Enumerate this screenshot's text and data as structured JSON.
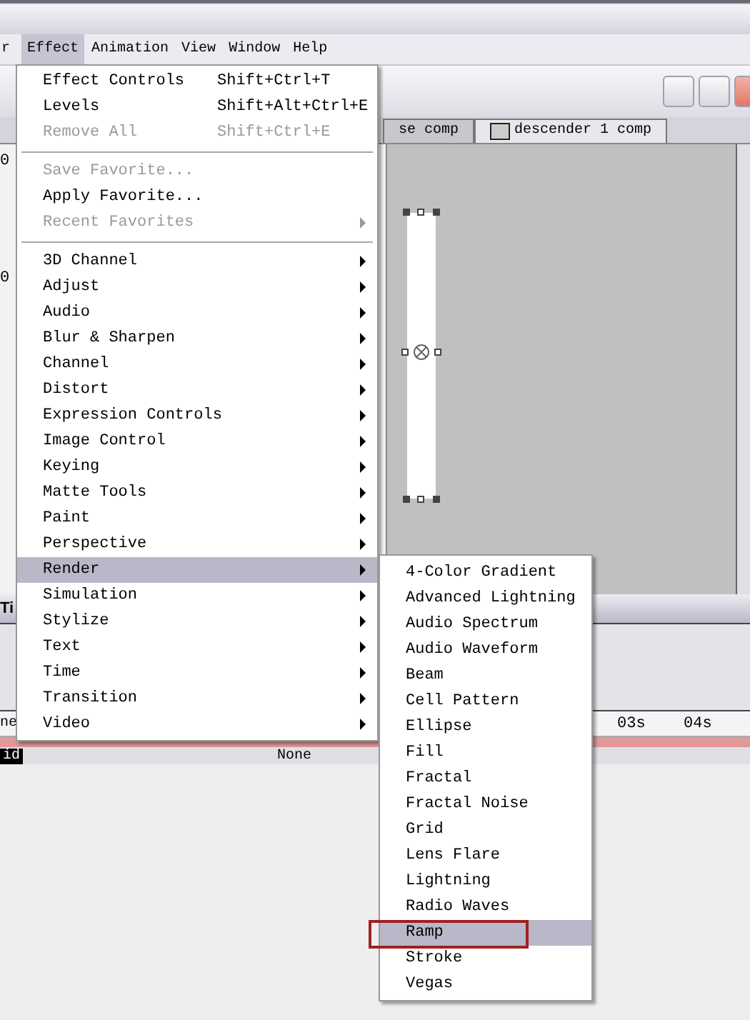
{
  "menubar": {
    "items": [
      {
        "label": "r",
        "selected": false
      },
      {
        "label": "Effect",
        "selected": true
      },
      {
        "label": "Animation",
        "selected": false
      },
      {
        "label": "View",
        "selected": false
      },
      {
        "label": "Window",
        "selected": false
      },
      {
        "label": "Help",
        "selected": false
      }
    ]
  },
  "comp_window": {
    "left_texts": [
      "0",
      "0"
    ],
    "tabs": [
      {
        "label": "se comp",
        "selected": false
      },
      {
        "label": "descender 1 comp",
        "selected": true
      }
    ]
  },
  "timeline": {
    "title": "Ti",
    "ruler_left": "ne",
    "ruler_marks": [
      "03s",
      "04s"
    ],
    "layer_name": "id",
    "layer_mode": "None"
  },
  "effect_menu": {
    "items": [
      {
        "kind": "item",
        "label": "Effect Controls",
        "shortcut": "Shift+Ctrl+T",
        "disabled": false,
        "submenu": false,
        "selected": false
      },
      {
        "kind": "item",
        "label": "Levels",
        "shortcut": "Shift+Alt+Ctrl+E",
        "disabled": false,
        "submenu": false,
        "selected": false
      },
      {
        "kind": "item",
        "label": "Remove All",
        "shortcut": "Shift+Ctrl+E",
        "disabled": true,
        "submenu": false,
        "selected": false
      },
      {
        "kind": "separator"
      },
      {
        "kind": "item",
        "label": "Save Favorite...",
        "disabled": true,
        "submenu": false,
        "selected": false
      },
      {
        "kind": "item",
        "label": "Apply Favorite...",
        "disabled": false,
        "submenu": false,
        "selected": false
      },
      {
        "kind": "item",
        "label": "Recent Favorites",
        "disabled": true,
        "submenu": true,
        "selected": false
      },
      {
        "kind": "separator"
      },
      {
        "kind": "item",
        "label": "3D Channel",
        "disabled": false,
        "submenu": true,
        "selected": false
      },
      {
        "kind": "item",
        "label": "Adjust",
        "disabled": false,
        "submenu": true,
        "selected": false
      },
      {
        "kind": "item",
        "label": "Audio",
        "disabled": false,
        "submenu": true,
        "selected": false
      },
      {
        "kind": "item",
        "label": "Blur & Sharpen",
        "disabled": false,
        "submenu": true,
        "selected": false
      },
      {
        "kind": "item",
        "label": "Channel",
        "disabled": false,
        "submenu": true,
        "selected": false
      },
      {
        "kind": "item",
        "label": "Distort",
        "disabled": false,
        "submenu": true,
        "selected": false
      },
      {
        "kind": "item",
        "label": "Expression Controls",
        "disabled": false,
        "submenu": true,
        "selected": false
      },
      {
        "kind": "item",
        "label": "Image Control",
        "disabled": false,
        "submenu": true,
        "selected": false
      },
      {
        "kind": "item",
        "label": "Keying",
        "disabled": false,
        "submenu": true,
        "selected": false
      },
      {
        "kind": "item",
        "label": "Matte Tools",
        "disabled": false,
        "submenu": true,
        "selected": false
      },
      {
        "kind": "item",
        "label": "Paint",
        "disabled": false,
        "submenu": true,
        "selected": false
      },
      {
        "kind": "item",
        "label": "Perspective",
        "disabled": false,
        "submenu": true,
        "selected": false
      },
      {
        "kind": "item",
        "label": "Render",
        "disabled": false,
        "submenu": true,
        "selected": true
      },
      {
        "kind": "item",
        "label": "Simulation",
        "disabled": false,
        "submenu": true,
        "selected": false
      },
      {
        "kind": "item",
        "label": "Stylize",
        "disabled": false,
        "submenu": true,
        "selected": false
      },
      {
        "kind": "item",
        "label": "Text",
        "disabled": false,
        "submenu": true,
        "selected": false
      },
      {
        "kind": "item",
        "label": "Time",
        "disabled": false,
        "submenu": true,
        "selected": false
      },
      {
        "kind": "item",
        "label": "Transition",
        "disabled": false,
        "submenu": true,
        "selected": false
      },
      {
        "kind": "item",
        "label": "Video",
        "disabled": false,
        "submenu": true,
        "selected": false
      }
    ]
  },
  "render_submenu": {
    "items": [
      {
        "label": "4-Color Gradient",
        "selected": false,
        "circled": false
      },
      {
        "label": "Advanced Lightning",
        "selected": false,
        "circled": false
      },
      {
        "label": "Audio Spectrum",
        "selected": false,
        "circled": false
      },
      {
        "label": "Audio Waveform",
        "selected": false,
        "circled": false
      },
      {
        "label": "Beam",
        "selected": false,
        "circled": false
      },
      {
        "label": "Cell Pattern",
        "selected": false,
        "circled": false
      },
      {
        "label": "Ellipse",
        "selected": false,
        "circled": false
      },
      {
        "label": "Fill",
        "selected": false,
        "circled": false
      },
      {
        "label": "Fractal",
        "selected": false,
        "circled": false
      },
      {
        "label": "Fractal Noise",
        "selected": false,
        "circled": false
      },
      {
        "label": "Grid",
        "selected": false,
        "circled": false
      },
      {
        "label": "Lens Flare",
        "selected": false,
        "circled": false
      },
      {
        "label": "Lightning",
        "selected": false,
        "circled": false
      },
      {
        "label": "Radio Waves",
        "selected": false,
        "circled": false
      },
      {
        "label": "Ramp",
        "selected": true,
        "circled": true
      },
      {
        "label": "Stroke",
        "selected": false,
        "circled": false
      },
      {
        "label": "Vegas",
        "selected": false,
        "circled": false
      }
    ]
  }
}
